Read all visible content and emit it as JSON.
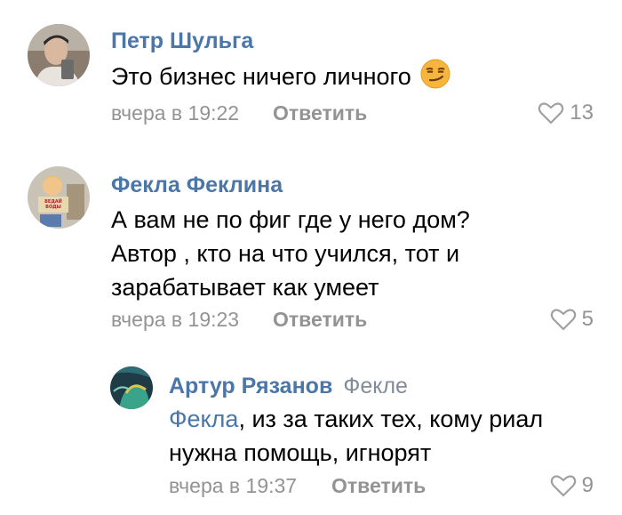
{
  "comments": [
    {
      "author": "Петр Шульга",
      "text": "Это бизнес ничего личного",
      "emoji": "smirk-emoji",
      "time": "вчера в 19:22",
      "reply_label": "Ответить",
      "likes": "13"
    },
    {
      "author": "Фекла Феклина",
      "lines": [
        "А вам не по фиг где у него дом?",
        "Автор , кто на что учился, тот и",
        "зарабатывает как умеет"
      ],
      "time": "вчера в 19:23",
      "reply_label": "Ответить",
      "likes": "5"
    },
    {
      "author": "Артур Рязанов",
      "reply_to": "Фекле",
      "mention": "Фекла",
      "line1_rest": ", из за таких тех, кому риал",
      "line2": "нужна помощь, игнорят",
      "time": "вчера в 19:37",
      "reply_label": "Ответить",
      "likes": "9"
    }
  ],
  "colors": {
    "link": "#4a76a8",
    "meta": "#939393",
    "text": "#000000"
  },
  "icons": {
    "like": "heart-outline-icon"
  }
}
